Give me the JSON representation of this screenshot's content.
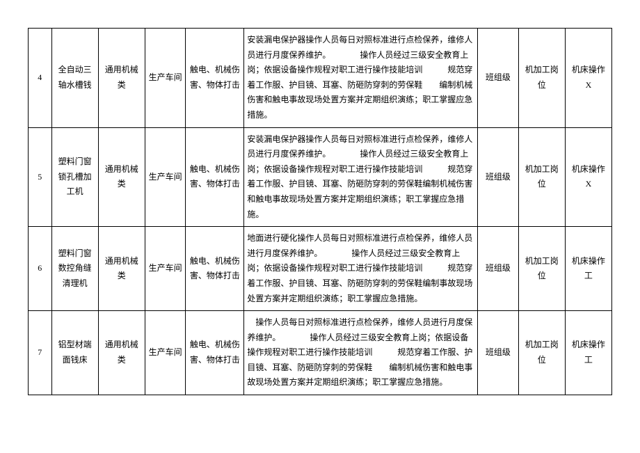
{
  "rows": [
    {
      "num": "4",
      "name": "全自动三轴水槽钱",
      "category": "通用机械类",
      "location": "生产车间",
      "hazard": "触电、机械伤害、物体打击",
      "desc": "安装漏电保护器操作人员每日对照标准进行点检保养，维修人员进行月度保养维护。　　　　操作人员经过三级安全教育上岗；依据设备操作规程对职工进行操作技能培训　　　规范穿着工作服、护目镜、耳塞、防砸防穿刺的劳保鞋　　编制机械伤害和触电事故现场处置方案并定期组织演练；职工掌握应急措施。",
      "level": "班组级",
      "post": "机加工岗位",
      "operator": "机床操作 X"
    },
    {
      "num": "5",
      "name": "塑料门窗锁孔槽加工机",
      "category": "通用机械类",
      "location": "生产车间",
      "hazard": "触电、机械伤害、物体打击",
      "desc": "安装漏电保护器操作人员每日对照标准进行点检保养，维修人员进行月度保养维护。　　　　操作人员经过三级安全教育上岗；依据设备操作规程对职工进行操作技能培训　　　规范穿着工作服、护目镜、耳塞、防砸防穿刺的劳保鞋编制机械伤害和触电事故现场处置方案并定期组织演练；职工掌握应急措施。",
      "level": "班组级",
      "post": "机加工岗位",
      "operator": "机床操作 X"
    },
    {
      "num": "6",
      "name": "塑料门窗数控角缝清理机",
      "category": "通用机械类",
      "location": "生产车间",
      "hazard": "触电、机械伤害、物体打击",
      "desc": "地面进行硬化操作人员每日对照标准进行点检保养，维修人员进行月度保养维护。　　　　操作人员经过三级安全教育上岗；依据设备操作规程对职工进行操作技能培训　　　规范穿着工作服、护目镜、耳塞、防砸防穿刺的劳保鞋编制事故现场处置方案并定期组织演练；职工掌握应急措施。",
      "level": "班组级",
      "post": "机加工岗位",
      "operator": "机床操作工"
    },
    {
      "num": "7",
      "name": "铝型材端面钱床",
      "category": "通用机械类",
      "location": "生产车间",
      "hazard": "触电、机械伤害、物体打击",
      "desc": "　操作人员每日对照标准进行点检保养，维修人员进行月度保养维护。　　　　操作人员经过三级安全教育上岗；依据设备操作规程对职工进行操作技能培训　　　规范穿着工作服、护目镜、耳塞、防砸防穿刺的劳保鞋　　编制机械伤害和触电事故现场处置方案并定期组织演练；职工掌握应急措施。",
      "level": "班组级",
      "post": "机加工岗位",
      "operator": "机床操作工"
    }
  ]
}
